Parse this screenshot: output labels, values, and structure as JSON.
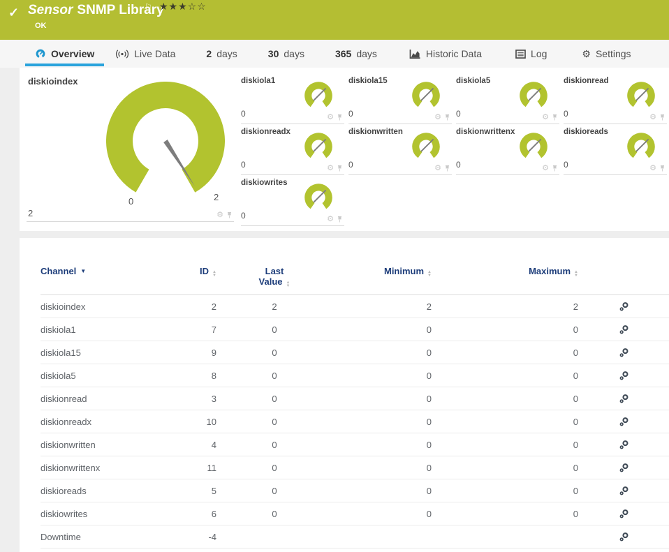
{
  "colors": {
    "banner_green": "#b4be33",
    "gauge_green": "#b2c32f",
    "needle_gray": "#7d7d7d",
    "tab_active_blue": "#2aa3dc",
    "table_header_navy": "#1d3d7a"
  },
  "icons": {
    "check": "✓",
    "flag": "⚐",
    "gear": "⚙",
    "sort_up": "▲",
    "sort_down": "▼",
    "caret_down": "▼"
  },
  "header": {
    "title_em": "Sensor",
    "title": "SNMP Library",
    "stars_filled": "★★★",
    "stars_empty": "☆☆",
    "status": "OK"
  },
  "tabs": {
    "overview": {
      "label": "Overview"
    },
    "live_data": {
      "label": "Live Data"
    },
    "d2": {
      "num": "2",
      "label": "days"
    },
    "d30": {
      "num": "30",
      "label": "days"
    },
    "d365": {
      "num": "365",
      "label": "days"
    },
    "historic": {
      "label": "Historic Data"
    },
    "log": {
      "label": "Log"
    },
    "settings": {
      "label": "Settings"
    }
  },
  "gauges": {
    "main": {
      "label": "diskioindex",
      "value": "2",
      "scale_min": "0",
      "scale_max": "2"
    },
    "small": [
      {
        "label": "diskiola1",
        "value": "0"
      },
      {
        "label": "diskiola15",
        "value": "0"
      },
      {
        "label": "diskiola5",
        "value": "0"
      },
      {
        "label": "diskionread",
        "value": "0"
      },
      {
        "label": "diskionreadx",
        "value": "0"
      },
      {
        "label": "diskionwritten",
        "value": "0"
      },
      {
        "label": "diskionwrittenx",
        "value": "0"
      },
      {
        "label": "diskioreads",
        "value": "0"
      },
      {
        "label": "diskiowrites",
        "value": "0"
      }
    ]
  },
  "table": {
    "columns": {
      "channel": "Channel",
      "id": "ID",
      "last_line1": "Last",
      "last_line2": "Value",
      "minimum": "Minimum",
      "maximum": "Maximum"
    },
    "rows": [
      {
        "channel": "diskioindex",
        "id": "2",
        "last": "2",
        "min": "2",
        "max": "2"
      },
      {
        "channel": "diskiola1",
        "id": "7",
        "last": "0",
        "min": "0",
        "max": "0"
      },
      {
        "channel": "diskiola15",
        "id": "9",
        "last": "0",
        "min": "0",
        "max": "0"
      },
      {
        "channel": "diskiola5",
        "id": "8",
        "last": "0",
        "min": "0",
        "max": "0"
      },
      {
        "channel": "diskionread",
        "id": "3",
        "last": "0",
        "min": "0",
        "max": "0"
      },
      {
        "channel": "diskionreadx",
        "id": "10",
        "last": "0",
        "min": "0",
        "max": "0"
      },
      {
        "channel": "diskionwritten",
        "id": "4",
        "last": "0",
        "min": "0",
        "max": "0"
      },
      {
        "channel": "diskionwrittenx",
        "id": "11",
        "last": "0",
        "min": "0",
        "max": "0"
      },
      {
        "channel": "diskioreads",
        "id": "5",
        "last": "0",
        "min": "0",
        "max": "0"
      },
      {
        "channel": "diskiowrites",
        "id": "6",
        "last": "0",
        "min": "0",
        "max": "0"
      },
      {
        "channel": "Downtime",
        "id": "-4",
        "last": "",
        "min": "",
        "max": ""
      }
    ]
  }
}
